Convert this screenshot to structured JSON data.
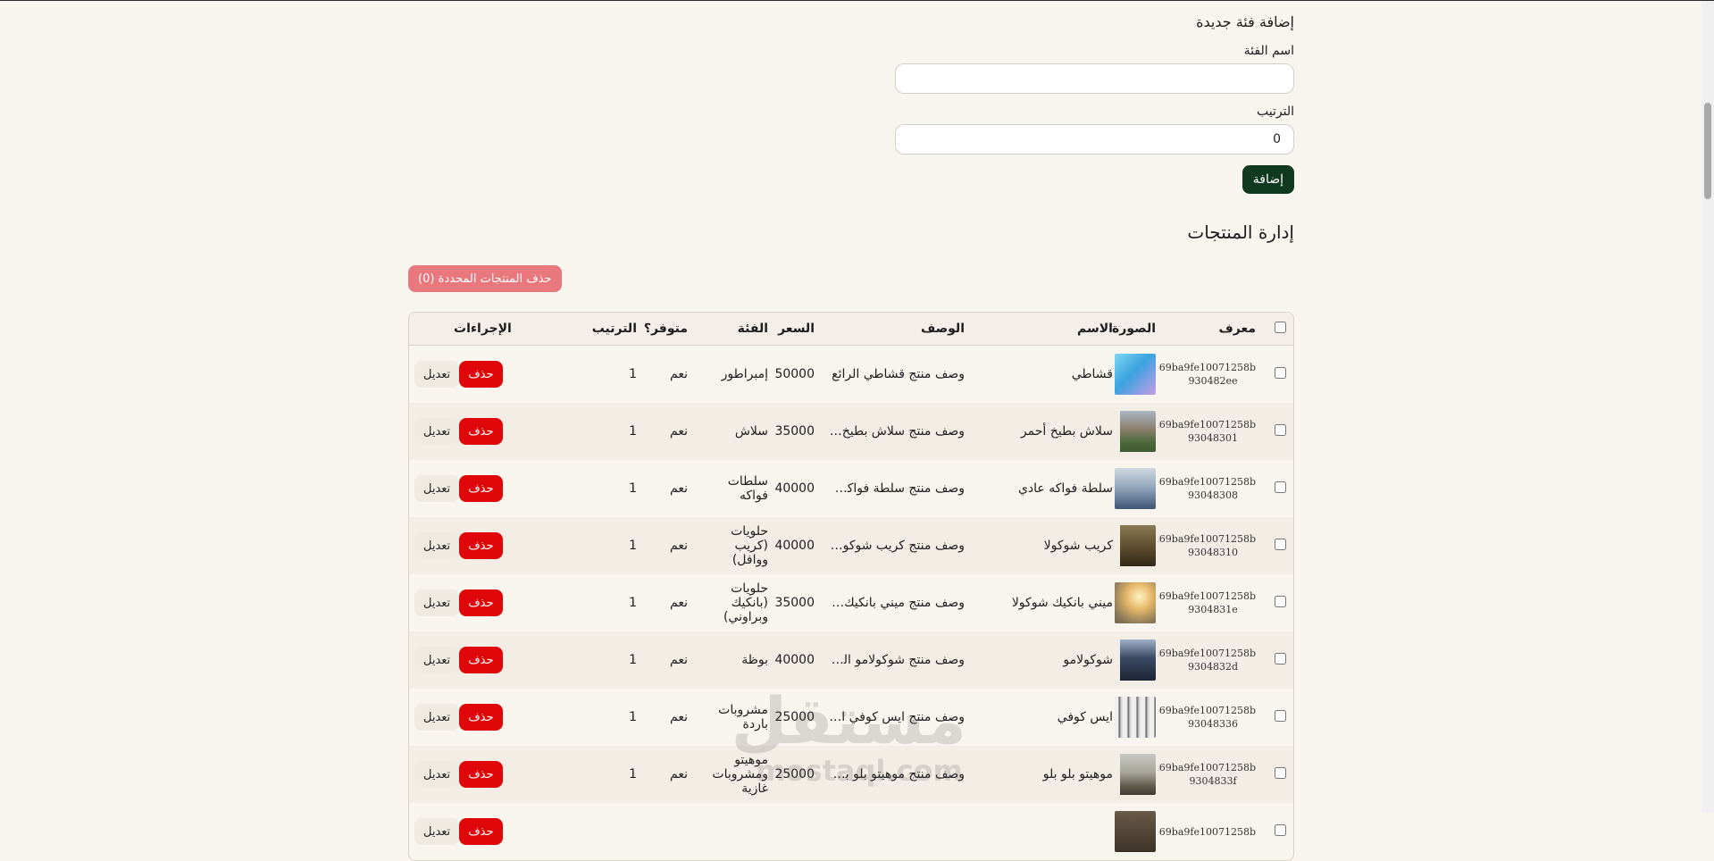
{
  "add_category": {
    "title": "إضافة فئة جديدة",
    "name_label": "اسم الفئة",
    "name_value": "",
    "order_label": "الترتيب",
    "order_value": "0",
    "submit_label": "إضافة"
  },
  "products": {
    "title": "إدارة المنتجات",
    "bulk_delete_label": "حذف المنتجات المحددة (0)",
    "columns": [
      "معرف",
      "الصورة",
      "الاسم",
      "الوصف",
      "السعر",
      "الفئة",
      "متوفر؟",
      "الترتيب",
      "الإجراءات"
    ],
    "edit_label": "تعديل",
    "delete_label": "حذف",
    "rows": [
      {
        "id_line1": "69ba9fe10071258b",
        "id_line2": "930482ee",
        "thumb": "laptop-image",
        "name": "قشاطي",
        "desc": "وصف منتج قشاطي الرائع",
        "price": "50000",
        "category": "إمبراطور",
        "available": "نعم",
        "order": "1"
      },
      {
        "id_line1": "69ba9fe10071258b",
        "id_line2": "93048301",
        "thumb": "building-image",
        "name": "سلاش بطيخ أحمر",
        "desc": "وصف منتج سلاش بطيخ أحمر ...",
        "price": "35000",
        "category": "سلاش",
        "available": "نعم",
        "order": "1"
      },
      {
        "id_line1": "69ba9fe10071258b",
        "id_line2": "93048308",
        "thumb": "lake-image",
        "name": "سلطة فواكه عادي",
        "desc": "وصف منتج سلطة فواكه عاد...",
        "price": "40000",
        "category": "سلطات فواكه",
        "available": "نعم",
        "order": "1"
      },
      {
        "id_line1": "69ba9fe10071258b",
        "id_line2": "93048310",
        "thumb": "deer-image",
        "name": "كريب شوكولا",
        "desc": "وصف منتج كريب شوكولا الرائع",
        "price": "40000",
        "category": "حلويات (كريب ووافل)",
        "available": "نعم",
        "order": "1"
      },
      {
        "id_line1": "69ba9fe10071258b",
        "id_line2": "9304831e",
        "thumb": "sunlight-image",
        "name": "ميني بانكيك شوكولا",
        "desc": "وصف منتج ميني بانكيك شوك...",
        "price": "35000",
        "category": "حلويات (بانكيك وبراوني)",
        "available": "نعم",
        "order": "1"
      },
      {
        "id_line1": "69ba9fe10071258b",
        "id_line2": "9304832d",
        "thumb": "forest-image",
        "name": "شوكولامو",
        "desc": "وصف منتج شوكولامو الرائع",
        "price": "40000",
        "category": "بوظة",
        "available": "نعم",
        "order": "1"
      },
      {
        "id_line1": "69ba9fe10071258b",
        "id_line2": "93048336",
        "thumb": "birch-image",
        "name": "ايس كوفي",
        "desc": "وصف منتج ايس كوفي الرائع",
        "price": "25000",
        "category": "مشروبات باردة",
        "available": "نعم",
        "order": "1"
      },
      {
        "id_line1": "69ba9fe10071258b",
        "id_line2": "9304833f",
        "thumb": "mountain-image",
        "name": "موهيتو بلو بلو",
        "desc": "وصف منتج موهيتو بلو بلو الر...",
        "price": "25000",
        "category": "موهيتو ومشروبات غازية",
        "available": "نعم",
        "order": "1"
      },
      {
        "id_line1": "69ba9fe10071258b",
        "id_line2": "",
        "thumb": "partial-image",
        "name": "",
        "desc": "",
        "price": "",
        "category": "",
        "available": "",
        "order": ""
      }
    ]
  },
  "watermark": {
    "arabic": "مستقل",
    "latin": "mostaql.com"
  },
  "colors": {
    "add_button": "#0f3a1f",
    "delete_button": "#e0070b",
    "bulk_delete_button": "#e8787d",
    "background": "#f8f5ef"
  }
}
